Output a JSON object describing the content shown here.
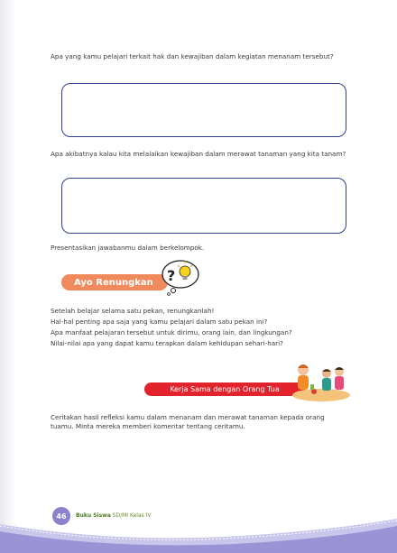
{
  "questions": {
    "q1": "Apa yang kamu pelajari terkait hak dan kewajiban dalam kegiatan menanam tersebut?",
    "q2": "Apa akibatnya kalau kita melalaikan kewajiban dalam merawat tanaman yang kita tanam?",
    "present": "Presentasikan jawabanmu dalam berkelompok."
  },
  "ayo_renungkan": {
    "title": "Ayo Renungkan",
    "icon": "question-lightbulb-icon",
    "lines": [
      "Setelah belajar selama satu pekan, renungkanlah!",
      "Hal-hal penting apa saja yang kamu pelajari dalam satu pekan ini?",
      "Apa manfaat pelajaran tersebut untuk dirimu, orang lain, dan lingkungan?",
      "Nilai-nilai apa yang dapat kamu terapkan dalam kehidupan sehari-hari?"
    ]
  },
  "kerja_sama": {
    "title": "Kerja Sama dengan Orang Tua",
    "text": "Ceritakan hasil refleksi kamu dalam menanam dan merawat tanaman kepada orang tuamu. Minta mereka memberi komentar tentang ceritamu."
  },
  "footer": {
    "page_number": "46",
    "book_bold": "Buku Siswa",
    "book_rest": " SD/MI Kelas IV"
  },
  "colors": {
    "box_border": "#2f3e8f",
    "renungkan": "#f08a5d",
    "kerja_sama": "#e3232b",
    "footer_wave": "#9a94d6"
  }
}
